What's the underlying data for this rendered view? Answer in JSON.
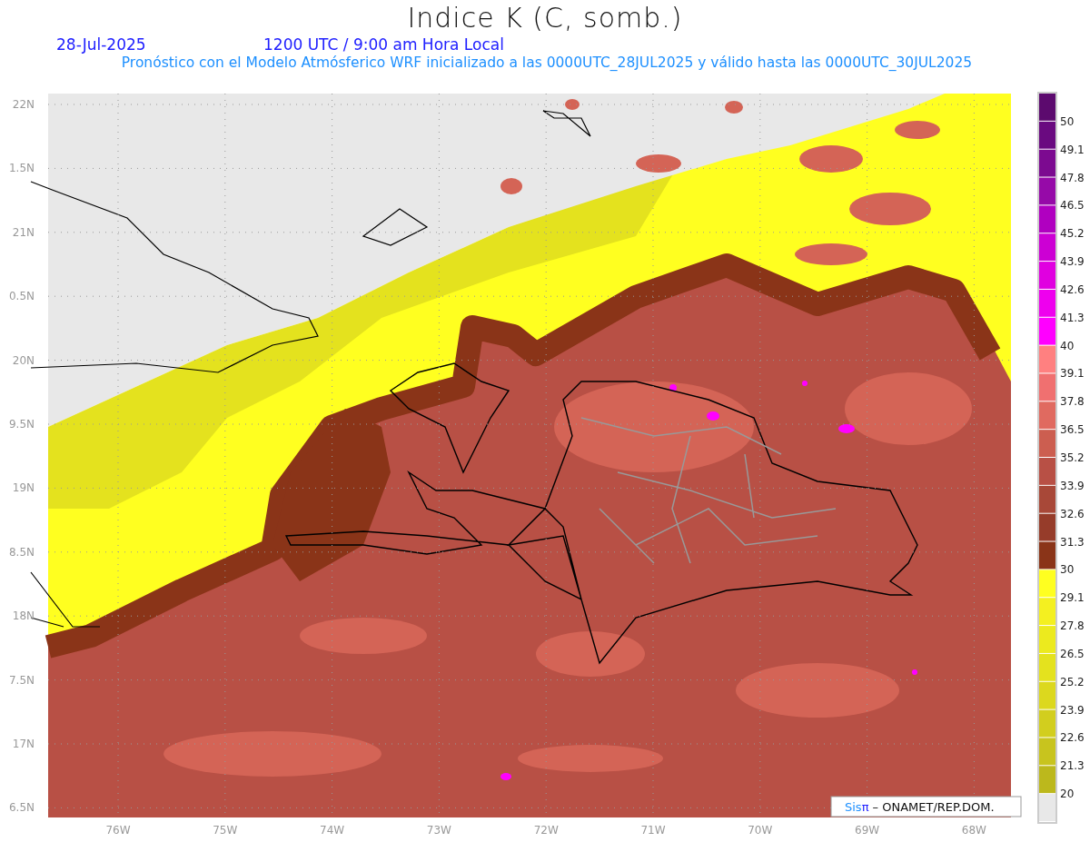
{
  "title": "Indice K (C, somb.)",
  "date": "28-Jul-2025",
  "time": "1200 UTC / 9:00 am Hora Local",
  "description": "Pronóstico con el Modelo Atmósferico WRF inicializado a las 0000UTC_28JUL2025 y válido hasta las  0000UTC_30JUL2025",
  "y_axis": [
    "22N",
    "1.5N",
    "21N",
    "0.5N",
    "20N",
    "9.5N",
    "19N",
    "8.5N",
    "18N",
    "7.5N",
    "17N",
    "6.5N"
  ],
  "x_axis": [
    "76W",
    "75W",
    "74W",
    "73W",
    "72W",
    "71W",
    "70W",
    "69W",
    "68W"
  ],
  "colorbar": {
    "bands": [
      {
        "color": "#5c0a6e",
        "label": "50"
      },
      {
        "color": "#6a0a80",
        "label": "49.1"
      },
      {
        "color": "#7c0a90",
        "label": "47.8"
      },
      {
        "color": "#960aa8",
        "label": "46.5"
      },
      {
        "color": "#b000c0",
        "label": "45.2"
      },
      {
        "color": "#cc00d4",
        "label": "43.9"
      },
      {
        "color": "#e000e0",
        "label": "42.6"
      },
      {
        "color": "#ee00ee",
        "label": "41.3"
      },
      {
        "color": "#ff00ff",
        "label": "40"
      },
      {
        "color": "#ff8080",
        "label": "39.1"
      },
      {
        "color": "#f07070",
        "label": "37.8"
      },
      {
        "color": "#e06a60",
        "label": "36.5"
      },
      {
        "color": "#cc5e50",
        "label": "35.2"
      },
      {
        "color": "#b85045",
        "label": "33.9"
      },
      {
        "color": "#a84838",
        "label": "32.6"
      },
      {
        "color": "#963c2a",
        "label": "31.3"
      },
      {
        "color": "#8a3418",
        "label": "30"
      },
      {
        "color": "#ffff20",
        "label": "29.1"
      },
      {
        "color": "#f4f020",
        "label": "27.8"
      },
      {
        "color": "#ecea1e",
        "label": "26.5"
      },
      {
        "color": "#e4e21e",
        "label": "25.2"
      },
      {
        "color": "#dcd81e",
        "label": "23.9"
      },
      {
        "color": "#d2ce1e",
        "label": "22.6"
      },
      {
        "color": "#c8c41e",
        "label": "21.3"
      },
      {
        "color": "#bcb81c",
        "label": "20"
      },
      {
        "color": "#e8e8e8"
      }
    ]
  },
  "credit": {
    "brand": "Sis",
    "brand_mark": "π",
    "text": "– ONAMET/REP.DOM."
  }
}
